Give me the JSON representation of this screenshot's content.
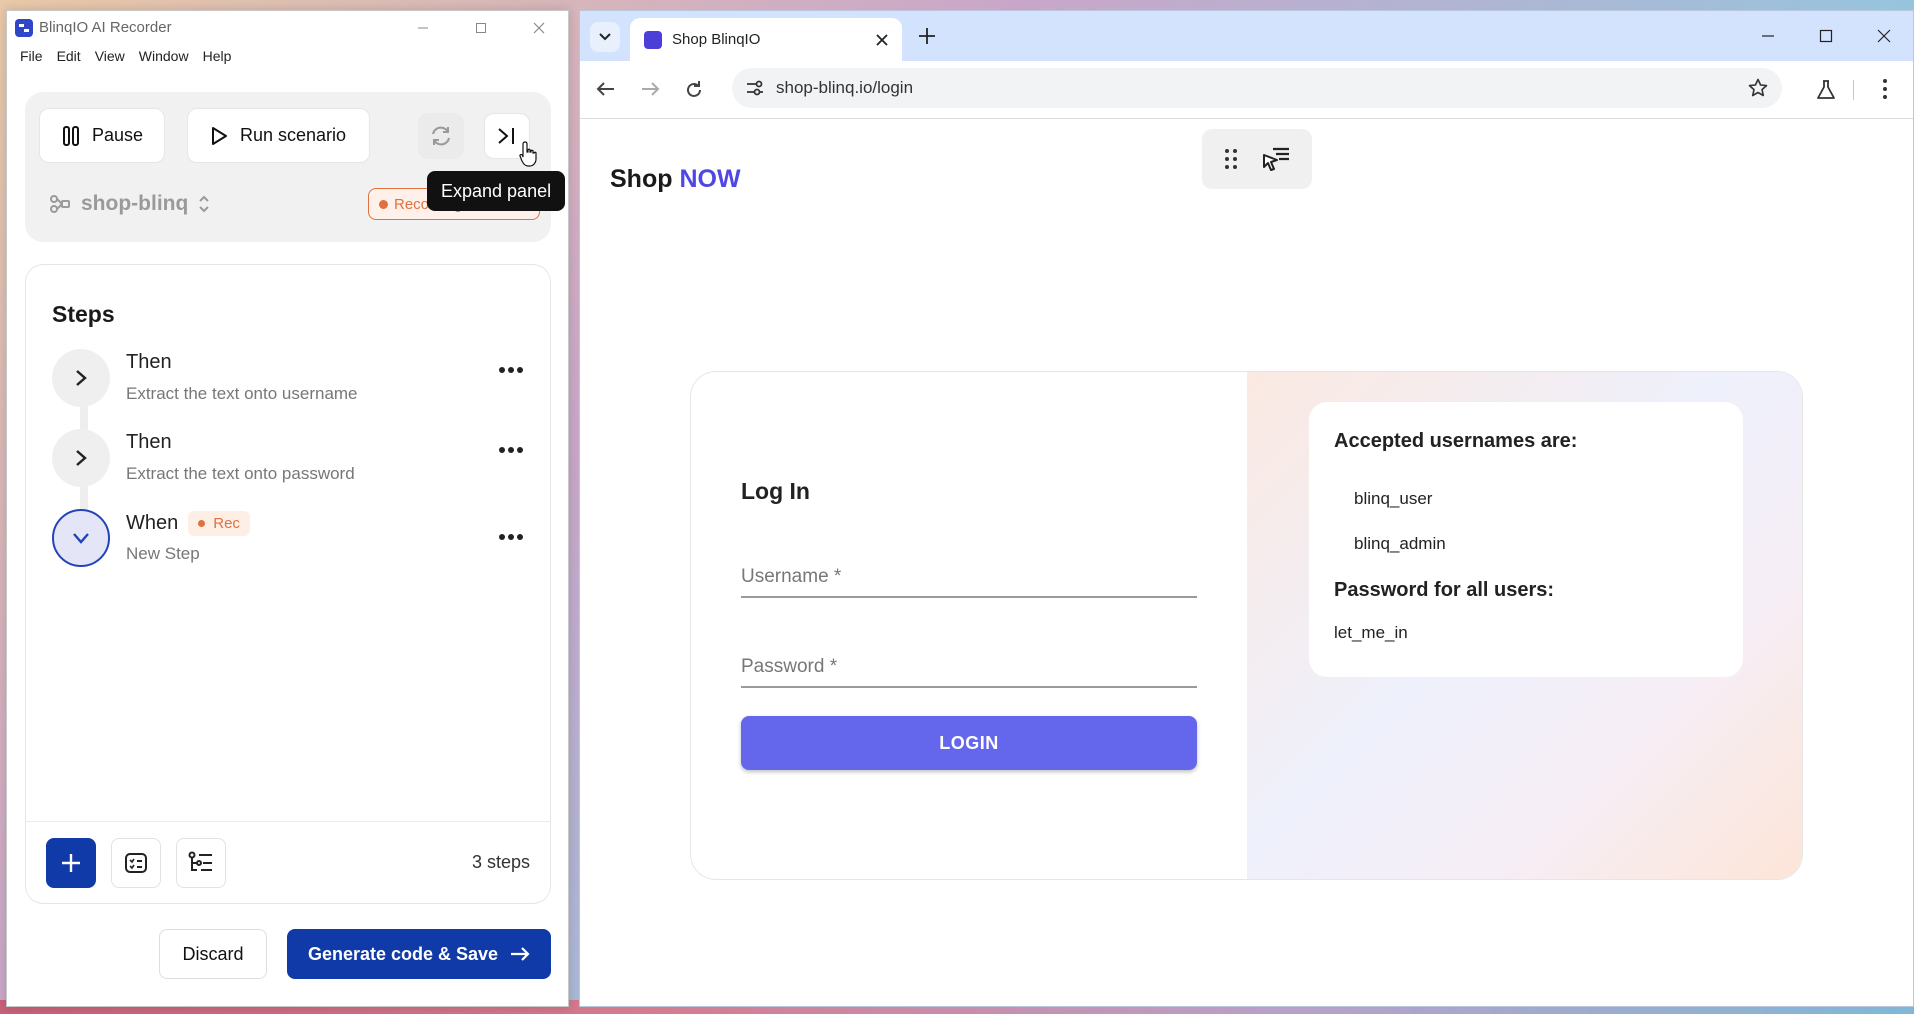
{
  "recorder": {
    "title": "BlinqIO AI Recorder",
    "menu": [
      "File",
      "Edit",
      "View",
      "Window",
      "Help"
    ],
    "pause_label": "Pause",
    "run_label": "Run scenario",
    "project_name": "shop-blinq",
    "recording_label": "Recording",
    "tooltip": "Expand panel",
    "steps_title": "Steps",
    "steps": [
      {
        "keyword": "Then",
        "description": "Extract the text onto username"
      },
      {
        "keyword": "Then",
        "description": "Extract the text onto password"
      },
      {
        "keyword": "When",
        "description": "New Step",
        "badge": "Rec"
      }
    ],
    "step_count": "3 steps",
    "discard_label": "Discard",
    "generate_label": "Generate code & Save"
  },
  "browser": {
    "tab_title": "Shop BlinqIO",
    "url": "shop-blinq.io/login"
  },
  "page": {
    "brand_main": "Shop",
    "brand_accent": "NOW",
    "login_title": "Log In",
    "username_placeholder": "Username *",
    "password_placeholder": "Password *",
    "login_button": "LOGIN",
    "accepted_heading": "Accepted usernames are:",
    "usernames": [
      "blinq_user",
      "blinq_admin"
    ],
    "password_heading": "Password for all users:",
    "password_value": "let_me_in"
  },
  "colors": {
    "primary_blue": "#0f3aa8",
    "accent_purple": "#4f46e5",
    "login_button": "#6466eb",
    "recording_orange": "#e0713f"
  }
}
